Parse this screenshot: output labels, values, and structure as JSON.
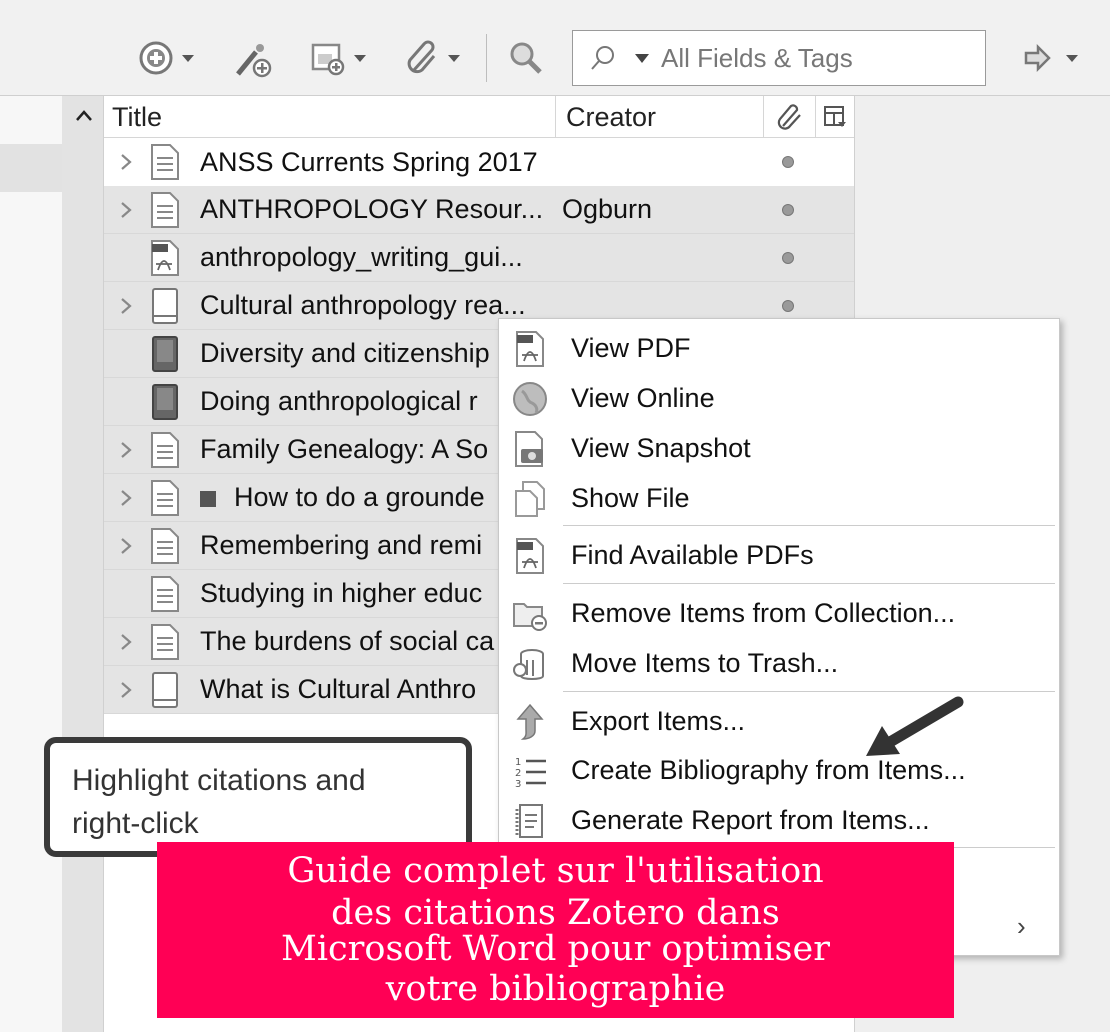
{
  "toolbar": {
    "search_placeholder": "All Fields & Tags",
    "icons": [
      "new-item-icon",
      "magic-wand-icon",
      "new-note-icon",
      "attachment-icon",
      "search-icon",
      "sync-arrow-icon"
    ]
  },
  "items_header": {
    "title": "Title",
    "creator": "Creator"
  },
  "items": [
    {
      "title": "ANSS Currents Spring 2017",
      "creator": "",
      "icon": "document-icon",
      "twisty": true,
      "selected": false,
      "attachment": true
    },
    {
      "title": "ANTHROPOLOGY Resour...",
      "creator": "Ogburn",
      "icon": "document-icon",
      "twisty": true,
      "selected": true,
      "attachment": true
    },
    {
      "title": "anthropology_writing_gui...",
      "creator": "",
      "icon": "pdf-icon",
      "twisty": false,
      "selected": true,
      "attachment": true
    },
    {
      "title": "Cultural anthropology rea...",
      "creator": "",
      "icon": "book-section-icon",
      "twisty": true,
      "selected": true,
      "attachment": true
    },
    {
      "title": "Diversity and citizenship",
      "creator": "",
      "icon": "book-icon",
      "twisty": false,
      "selected": true,
      "attachment": false
    },
    {
      "title": "Doing anthropological r",
      "creator": "",
      "icon": "book-icon",
      "twisty": false,
      "selected": true,
      "attachment": false
    },
    {
      "title": "Family Genealogy: A So",
      "creator": "",
      "icon": "document-icon",
      "twisty": true,
      "selected": true,
      "attachment": false
    },
    {
      "title": "How to do a grounde",
      "creator": "",
      "icon": "document-icon",
      "twisty": true,
      "selected": true,
      "attachment": false,
      "tag": true
    },
    {
      "title": "Remembering and remi",
      "creator": "",
      "icon": "document-icon",
      "twisty": true,
      "selected": true,
      "attachment": false
    },
    {
      "title": "Studying in higher educ",
      "creator": "",
      "icon": "document-icon",
      "twisty": false,
      "selected": true,
      "attachment": false
    },
    {
      "title": "The burdens of social ca",
      "creator": "",
      "icon": "document-icon",
      "twisty": true,
      "selected": true,
      "attachment": false
    },
    {
      "title": "What is Cultural Anthro",
      "creator": "",
      "icon": "book-section-icon",
      "twisty": true,
      "selected": true,
      "attachment": false
    }
  ],
  "context_menu": {
    "view_pdf": "View PDF",
    "view_online": "View Online",
    "view_snapshot": "View Snapshot",
    "show_file": "Show File",
    "find_pdfs": "Find Available PDFs",
    "remove_from_collection": "Remove Items from Collection...",
    "move_to_trash": "Move Items to Trash...",
    "export_items": "Export Items...",
    "create_bibliography": "Create Bibliography from Items...",
    "generate_report": "Generate Report from Items..."
  },
  "callout": {
    "line1": "Highlight citations and",
    "line2": "right-click"
  },
  "banner": {
    "line1": "Guide complet sur l'utilisation",
    "line2": "des citations Zotero dans",
    "line3": "Microsoft Word pour optimiser",
    "line4": "votre bibliographie"
  },
  "colors": {
    "banner": "#ff0055",
    "selection": "#e4e4e4"
  }
}
